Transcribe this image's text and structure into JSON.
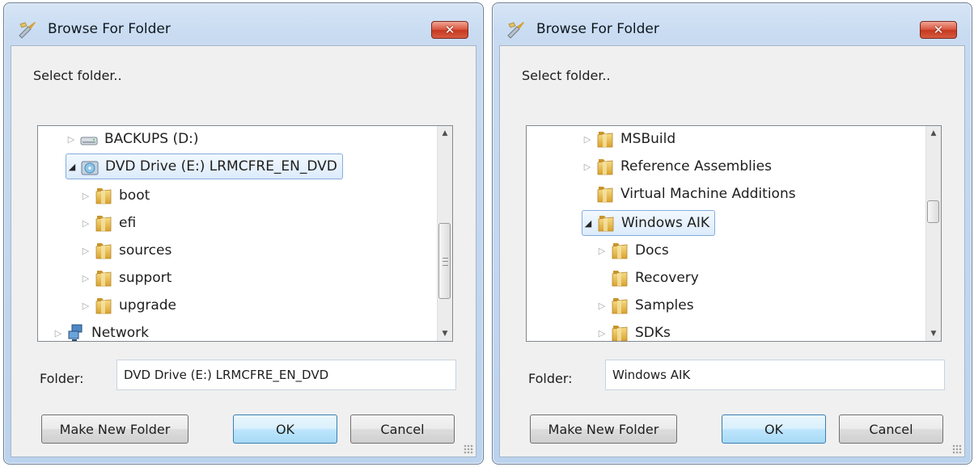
{
  "dialogs": [
    {
      "title": "Browse For Folder",
      "close_label": "✕",
      "prompt": "Select folder..",
      "tree": [
        {
          "label": "BACKUPS (D:)",
          "icon": "hard-drive-icon"
        },
        {
          "label": "DVD Drive (E:) LRMCFRE_EN_DVD",
          "icon": "dvd-drive-icon",
          "selected": true
        },
        {
          "label": "boot",
          "icon": "folder-icon"
        },
        {
          "label": "efi",
          "icon": "folder-icon"
        },
        {
          "label": "sources",
          "icon": "folder-icon"
        },
        {
          "label": "support",
          "icon": "folder-icon"
        },
        {
          "label": "upgrade",
          "icon": "folder-icon"
        },
        {
          "label": "Network",
          "icon": "network-icon"
        }
      ],
      "folder_label": "Folder:",
      "folder_value": "DVD Drive (E:) LRMCFRE_EN_DVD",
      "buttons": {
        "make_new_folder": "Make New Folder",
        "ok": "OK",
        "cancel": "Cancel"
      }
    },
    {
      "title": "Browse For Folder",
      "close_label": "✕",
      "prompt": "Select folder..",
      "tree": [
        {
          "label": "MSBuild",
          "icon": "folder-icon"
        },
        {
          "label": "Reference Assemblies",
          "icon": "folder-icon"
        },
        {
          "label": "Virtual Machine Additions",
          "icon": "folder-icon"
        },
        {
          "label": "Windows AIK",
          "icon": "folder-icon",
          "selected": true
        },
        {
          "label": "Docs",
          "icon": "folder-icon"
        },
        {
          "label": "Recovery",
          "icon": "folder-icon"
        },
        {
          "label": "Samples",
          "icon": "folder-icon"
        },
        {
          "label": "SDKs",
          "icon": "folder-icon"
        }
      ],
      "folder_label": "Folder:",
      "folder_value": "Windows AIK",
      "buttons": {
        "make_new_folder": "Make New Folder",
        "ok": "OK",
        "cancel": "Cancel"
      }
    }
  ],
  "colors": {
    "title_bar": "#c8dbf1",
    "close_button": "#d9553e",
    "selection": "#dcebfc",
    "default_button": "#bee6fd",
    "folder": "#e8b93a"
  }
}
